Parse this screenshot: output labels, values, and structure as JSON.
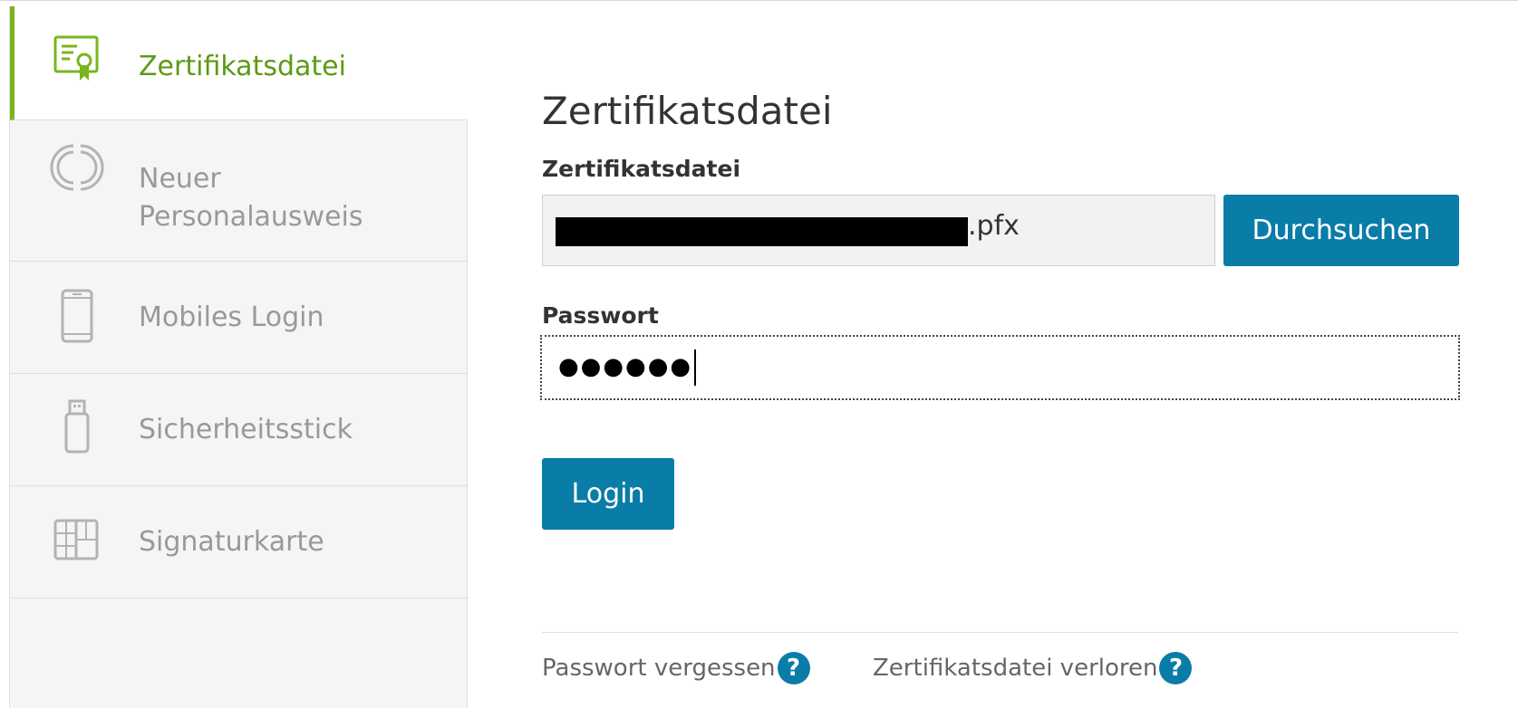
{
  "sidebar": {
    "items": [
      {
        "label": "Zertifikatsdatei",
        "icon": "certificate-icon",
        "active": true
      },
      {
        "label": "Neuer Personalausweis",
        "icon": "id-card-nfc-icon",
        "active": false
      },
      {
        "label": "Mobiles Login",
        "icon": "smartphone-icon",
        "active": false
      },
      {
        "label": "Sicherheitsstick",
        "icon": "usb-stick-icon",
        "active": false
      },
      {
        "label": "Signaturkarte",
        "icon": "signature-card-icon",
        "active": false
      }
    ]
  },
  "main": {
    "title": "Zertifikatsdatei",
    "file_label": "Zertifikatsdatei",
    "file_value_visible": ".pfx",
    "browse_label": "Durchsuchen",
    "password_label": "Passwort",
    "password_masked": "●●●●●●",
    "login_label": "Login"
  },
  "footer": {
    "forgot_password": "Passwort vergessen",
    "lost_certificate": "Zertifikatsdatei verloren",
    "help_glyph": "?"
  },
  "colors": {
    "accent_green": "#7ab51d",
    "button_blue": "#0a7ca8",
    "sidebar_bg": "#f5f5f5"
  }
}
